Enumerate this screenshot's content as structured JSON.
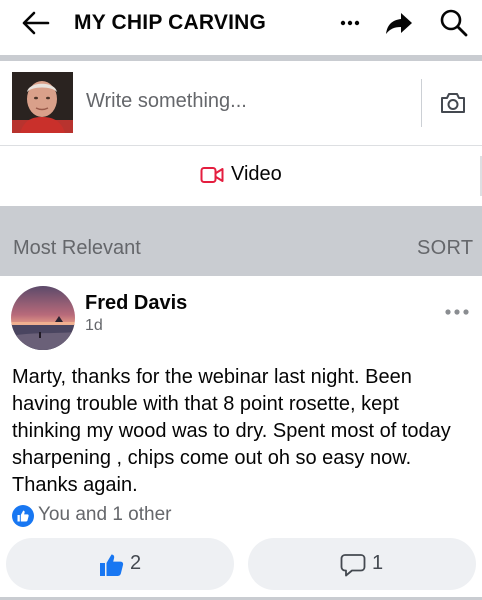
{
  "header": {
    "title": "MY CHIP CARVING",
    "icons": [
      "back-arrow-icon",
      "more-icon",
      "share-icon",
      "search-icon"
    ]
  },
  "composer": {
    "placeholder": "Write something...",
    "video_label": "Video",
    "icons": [
      "camera-icon",
      "video-icon"
    ]
  },
  "sortbar": {
    "label": "Most Relevant",
    "sort_label": "SORT"
  },
  "post": {
    "author": "Fred Davis",
    "time": "1d",
    "body": "Marty, thanks for the webinar last night. Been having trouble with that 8 point rosette, kept thinking my wood was to dry. Spent most of today sharpening , chips come out oh so easy now. Thanks again.",
    "reactions_text": "You and 1 other",
    "like_count": "2",
    "comment_count": "1"
  },
  "colors": {
    "accent_blue": "#1877f2",
    "video_red": "#e41e3f",
    "gray_bar": "#c9ccd1"
  }
}
